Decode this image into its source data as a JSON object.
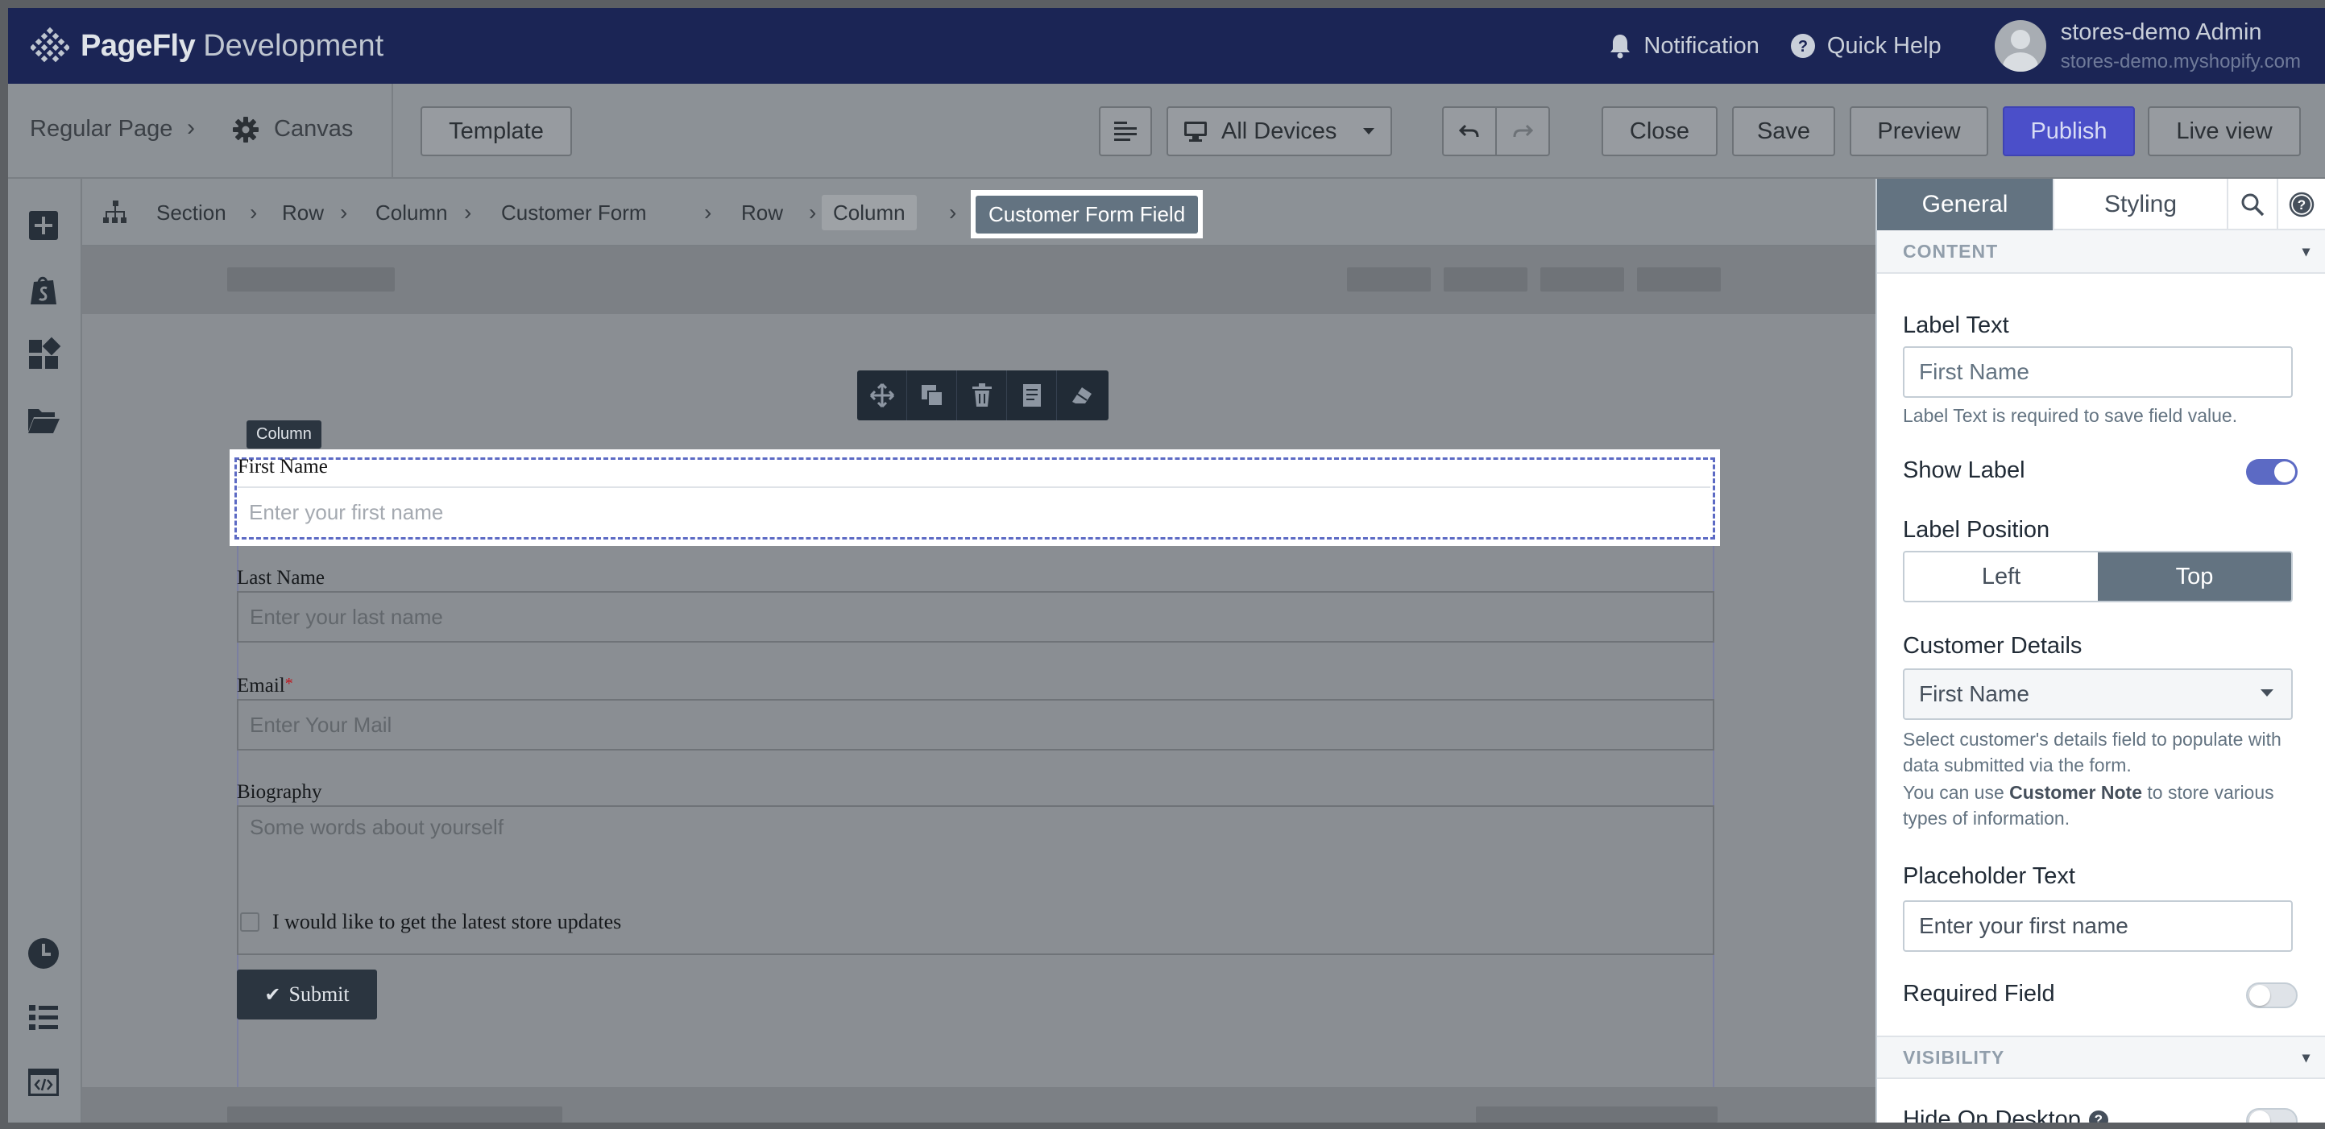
{
  "app": {
    "brand_strong": "PageFly",
    "brand_light": "Development",
    "notification_label": "Notification",
    "quick_help_label": "Quick Help",
    "user_name": "stores-demo Admin",
    "user_shop": "stores-demo.myshopify.com"
  },
  "toolbar": {
    "page_type": "Regular Page",
    "canvas_label": "Canvas",
    "template_label": "Template",
    "devices_label": "All Devices",
    "close_label": "Close",
    "save_label": "Save",
    "preview_label": "Preview",
    "publish_label": "Publish",
    "live_view_label": "Live view"
  },
  "breadcrumb": {
    "items": [
      "Section",
      "Row",
      "Column",
      "Customer Form",
      "Row",
      "Column"
    ],
    "current": "Customer Form Field"
  },
  "canvas": {
    "column_tag": "Column",
    "fields": [
      {
        "label": "First Name",
        "placeholder": "Enter your first name"
      },
      {
        "label": "Last Name",
        "placeholder": "Enter your last name"
      },
      {
        "label": "Email",
        "placeholder": "Enter Your Mail",
        "required": true
      },
      {
        "label": "Biography",
        "placeholder": "Some words about yourself"
      }
    ],
    "required_mark": "*",
    "checkbox_label": "I would like to get the latest store updates",
    "submit_label": "Submit"
  },
  "panel": {
    "tabs": [
      "General",
      "Styling"
    ],
    "active_tab": "General",
    "content_header": "CONTENT",
    "label_text_label": "Label Text",
    "label_text_value": "First Name",
    "label_text_help": "Label Text is required to save field value.",
    "show_label_label": "Show Label",
    "show_label_on": true,
    "label_position_label": "Label Position",
    "label_position_options": [
      "Left",
      "Top"
    ],
    "label_position_selected": "Top",
    "customer_details_label": "Customer Details",
    "customer_details_value": "First Name",
    "customer_details_help": "Select customer's details field to populate with data submitted via the form.",
    "customer_note_prefix": "You can use",
    "customer_note_strong": "Customer Note",
    "customer_note_suffix": "to store various types of information.",
    "placeholder_label": "Placeholder Text",
    "placeholder_value": "Enter your first name",
    "required_label": "Required Field",
    "required_on": false,
    "visibility_header": "VISIBILITY",
    "hide_desktop_label": "Hide On Desktop",
    "hide_desktop_on": false
  },
  "colors": {
    "topbar": "#1b2555",
    "publish": "#4b4fc9",
    "accent": "#5c6ac4",
    "active_tab": "#637381"
  }
}
